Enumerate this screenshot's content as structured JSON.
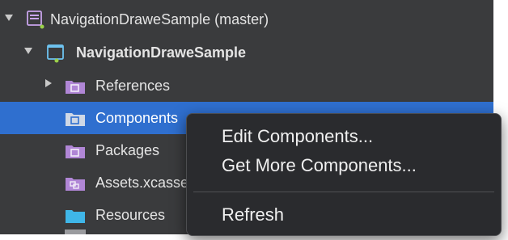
{
  "solution_tree": {
    "items": [
      {
        "label": "NavigationDraweSample (master)",
        "icon": "solution-icon",
        "disclosure": "open"
      },
      {
        "label": "NavigationDraweSample",
        "icon": "project-icon",
        "disclosure": "open"
      },
      {
        "label": "References",
        "icon": "folder-references-icon",
        "disclosure": "closed"
      },
      {
        "label": "Components",
        "icon": "folder-components-icon",
        "selected": true
      },
      {
        "label": "Packages",
        "icon": "folder-packages-icon"
      },
      {
        "label": "Assets.xcassets",
        "icon": "asset-catalog-icon"
      },
      {
        "label": "Resources",
        "icon": "folder-icon"
      }
    ]
  },
  "context_menu": {
    "items": [
      {
        "label": "Edit Components..."
      },
      {
        "label": "Get More Components..."
      },
      {
        "label": "Refresh"
      }
    ]
  },
  "colors": {
    "pad_background": "#3a3b3d",
    "selection": "#2f6fcf",
    "menu_background": "#2a2b2e",
    "folder_purple": "#b086d6",
    "folder_blue": "#3fb6e8",
    "project_green": "#9bd14a"
  }
}
